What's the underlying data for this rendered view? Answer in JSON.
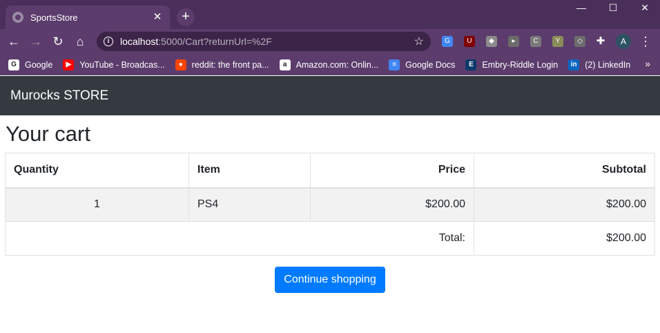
{
  "browser": {
    "tab_title": "SportsStore",
    "url_host": "localhost",
    "url_rest": ":5000/Cart?returnUrl=%2F",
    "profile_initial": "A",
    "bookmarks": [
      {
        "label": "Google",
        "icon": "google-icon",
        "color": "#ffffff",
        "glyph": "G"
      },
      {
        "label": "YouTube - Broadcas...",
        "icon": "youtube-icon",
        "color": "#ff0000",
        "glyph": "▶"
      },
      {
        "label": "reddit: the front pa...",
        "icon": "reddit-icon",
        "color": "#ff4500",
        "glyph": "●"
      },
      {
        "label": "Amazon.com: Onlin...",
        "icon": "amazon-icon",
        "color": "#ffffff",
        "glyph": "a"
      },
      {
        "label": "Google Docs",
        "icon": "google-docs-icon",
        "color": "#4285f4",
        "glyph": "≡"
      },
      {
        "label": "Embry-Riddle Login",
        "icon": "embry-riddle-icon",
        "color": "#0a3a6b",
        "glyph": "E"
      },
      {
        "label": "(2) LinkedIn",
        "icon": "linkedin-icon",
        "color": "#0a66c2",
        "glyph": "in"
      }
    ]
  },
  "app": {
    "brand": "Murocks STORE",
    "heading": "Your cart"
  },
  "cart": {
    "headers": {
      "quantity": "Quantity",
      "item": "Item",
      "price": "Price",
      "subtotal": "Subtotal"
    },
    "rows": [
      {
        "quantity": "1",
        "item": "PS4",
        "price": "$200.00",
        "subtotal": "$200.00"
      }
    ],
    "total_label": "Total:",
    "total_value": "$200.00"
  },
  "actions": {
    "continue_label": "Continue shopping"
  },
  "colors": {
    "navbar": "#343a40",
    "primary": "#007bff",
    "browser_frame": "#5c3c6c"
  }
}
